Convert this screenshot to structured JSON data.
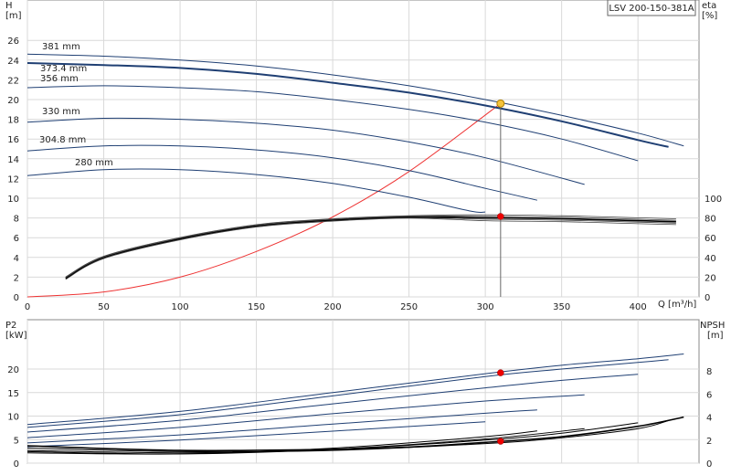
{
  "chart_data": [
    {
      "type": "line",
      "title": "LSV 200-150-381A",
      "xlabel": "Q [m³/h]",
      "ylabel_left": "H\n[m]",
      "ylabel_right": "eta\n[%]",
      "xlim": [
        0,
        440
      ],
      "ylim_left": [
        0,
        27
      ],
      "ylim_right_ticks": [
        0,
        20,
        40,
        60,
        80,
        100
      ],
      "x_ticks": [
        0,
        50,
        100,
        150,
        200,
        250,
        300,
        350,
        400
      ],
      "y_ticks_left": [
        0,
        2,
        4,
        6,
        8,
        10,
        12,
        14,
        16,
        18,
        20,
        22,
        24,
        26
      ],
      "grid": true,
      "series": [
        {
          "name": "381 mm",
          "x": [
            0,
            50,
            100,
            150,
            200,
            250,
            300,
            350,
            400,
            430
          ],
          "y": [
            24.6,
            24.4,
            24.0,
            23.4,
            22.5,
            21.4,
            20.0,
            18.4,
            16.6,
            15.3
          ]
        },
        {
          "name": "373.4 mm",
          "x": [
            0,
            50,
            100,
            150,
            200,
            250,
            300,
            350,
            400,
            420
          ],
          "y": [
            23.7,
            23.5,
            23.2,
            22.6,
            21.7,
            20.7,
            19.4,
            17.8,
            15.9,
            15.2
          ]
        },
        {
          "name": "356 mm",
          "x": [
            0,
            50,
            100,
            150,
            200,
            250,
            300,
            350,
            400
          ],
          "y": [
            21.2,
            21.4,
            21.2,
            20.8,
            20.0,
            19.0,
            17.7,
            16.0,
            13.8
          ]
        },
        {
          "name": "330 mm",
          "x": [
            0,
            50,
            100,
            150,
            200,
            250,
            300,
            365
          ],
          "y": [
            17.7,
            18.1,
            18.0,
            17.6,
            16.9,
            15.7,
            14.1,
            11.4
          ]
        },
        {
          "name": "304.8 mm",
          "x": [
            0,
            50,
            100,
            150,
            200,
            250,
            300,
            334
          ],
          "y": [
            14.8,
            15.3,
            15.3,
            14.9,
            14.1,
            12.8,
            11.0,
            9.8
          ]
        },
        {
          "name": "280 mm",
          "x": [
            0,
            50,
            100,
            150,
            200,
            250,
            290,
            300
          ],
          "y": [
            12.3,
            12.9,
            12.9,
            12.4,
            11.5,
            10.1,
            8.7,
            8.6
          ]
        }
      ],
      "system_curve": {
        "x": [
          0,
          50,
          100,
          150,
          200,
          250,
          310
        ],
        "y": [
          0,
          0.5,
          2.0,
          4.6,
          8.1,
          12.7,
          19.6
        ]
      },
      "efficiency": {
        "x": [
          25,
          50,
          100,
          150,
          200,
          250,
          300,
          350,
          400,
          425
        ],
        "y": [
          19,
          40,
          59,
          72,
          78,
          81,
          82,
          81,
          79,
          78
        ]
      },
      "operating_point": {
        "q": 310,
        "h": 19.6,
        "eta": 81.5
      }
    },
    {
      "type": "line",
      "ylabel_left": "P2\n[kW]",
      "ylabel_right": "NPSH\n[m]",
      "xlim": [
        0,
        440
      ],
      "y_ticks_left": [
        0,
        5,
        10,
        15,
        20
      ],
      "y_ticks_right": [
        0,
        2,
        4,
        6,
        8
      ],
      "grid": true,
      "power_series": [
        {
          "x": [
            0,
            100,
            200,
            300,
            350,
            400,
            430
          ],
          "y": [
            8.2,
            11.0,
            15.0,
            19.0,
            20.8,
            22.2,
            23.2
          ]
        },
        {
          "x": [
            0,
            100,
            200,
            300,
            350,
            400,
            420
          ],
          "y": [
            7.6,
            10.3,
            14.3,
            18.4,
            20.0,
            21.4,
            22.0
          ]
        },
        {
          "x": [
            0,
            100,
            200,
            300,
            350,
            400
          ],
          "y": [
            6.6,
            9.1,
            12.6,
            16.0,
            17.6,
            18.9
          ]
        },
        {
          "x": [
            0,
            100,
            200,
            300,
            365
          ],
          "y": [
            5.4,
            7.6,
            10.5,
            13.2,
            14.5
          ]
        },
        {
          "x": [
            0,
            100,
            200,
            300,
            334
          ],
          "y": [
            4.3,
            6.0,
            8.3,
            10.6,
            11.3
          ]
        },
        {
          "x": [
            0,
            100,
            200,
            300
          ],
          "y": [
            3.5,
            4.9,
            6.8,
            8.8
          ]
        }
      ],
      "npsh_series": [
        {
          "x": [
            0,
            100,
            200,
            250,
            300,
            350,
            400,
            430
          ],
          "y": [
            1.5,
            1.1,
            1.2,
            1.4,
            1.8,
            2.3,
            3.2,
            4.0
          ]
        },
        {
          "x": [
            0,
            100,
            200,
            300,
            350,
            400,
            420
          ],
          "y": [
            1.3,
            1.0,
            1.1,
            1.7,
            2.2,
            3.0,
            3.7
          ]
        },
        {
          "x": [
            0,
            100,
            200,
            300,
            350,
            400
          ],
          "y": [
            1.1,
            0.9,
            1.2,
            2.0,
            2.6,
            3.5
          ]
        },
        {
          "x": [
            0,
            100,
            200,
            300,
            365
          ],
          "y": [
            1.0,
            0.8,
            1.2,
            2.1,
            3.0
          ]
        },
        {
          "x": [
            0,
            100,
            200,
            300,
            334
          ],
          "y": [
            0.9,
            0.8,
            1.3,
            2.3,
            2.8
          ]
        }
      ],
      "operating_point": {
        "q": 310,
        "p2": 19.2,
        "npsh": 1.9
      }
    }
  ]
}
